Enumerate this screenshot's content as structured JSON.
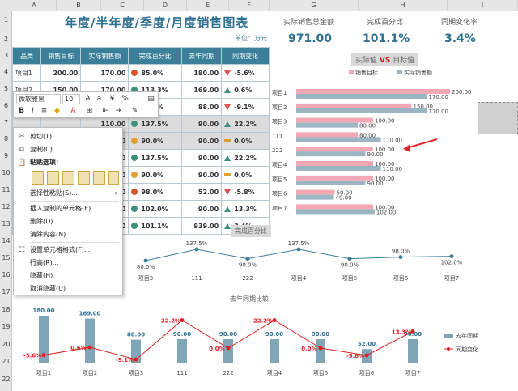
{
  "columns": [
    "A",
    "B",
    "C",
    "D",
    "E",
    "F",
    "G",
    "H",
    "I"
  ],
  "rows": [
    "1",
    "2",
    "3",
    "4",
    "5",
    "6",
    "7",
    "8",
    "9",
    "10",
    "11",
    "12",
    "13",
    "14",
    "15",
    "16",
    "17",
    "18",
    "19",
    "20",
    "21",
    "22"
  ],
  "title": "年度/半年度/季度/月度销售图表",
  "unit": "单位：万元",
  "kpi": {
    "total_label": "实际销售总金额",
    "total_value": "971.00",
    "pct_label": "完成百分比",
    "pct_value": "101.1%",
    "yoy_label": "同期变化率",
    "yoy_value": "3.4%"
  },
  "table": {
    "headers": [
      "品类",
      "销售目标",
      "实际销售额",
      "完成百分比",
      "去年同期",
      "同期变化"
    ],
    "rows": [
      {
        "name": "项目1",
        "target": "200.00",
        "actual": "170.00",
        "pct": "85.0%",
        "last": "180.00",
        "chg": "-5.6%",
        "dot": "#d9532b",
        "arrow": "dn"
      },
      {
        "name": "项目2",
        "target": "150.00",
        "actual": "170.00",
        "pct": "113.3%",
        "last": "169.00",
        "chg": "0.6%",
        "dot": "#3f8f7f",
        "arrow": "up"
      },
      {
        "name": "项目3",
        "target": "100.00",
        "actual": "80.00",
        "pct": "80.0%",
        "last": "88.00",
        "chg": "-9.1%",
        "dot": "#d9532b",
        "arrow": "dn"
      },
      {
        "name": "",
        "target": "",
        "actual": "110.00",
        "pct": "137.5%",
        "last": "90.00",
        "chg": "22.2%",
        "dot": "#3f8f7f",
        "arrow": "up"
      },
      {
        "name": "",
        "target": "",
        "actual": "90.00",
        "pct": "90.0%",
        "last": "90.00",
        "chg": "0.0%",
        "dot": "#e0a030",
        "arrow": "eq"
      },
      {
        "name": "",
        "target": "",
        "actual": "110.00",
        "pct": "137.5%",
        "last": "90.00",
        "chg": "22.2%",
        "dot": "#3f8f7f",
        "arrow": "up"
      },
      {
        "name": "",
        "target": "",
        "actual": "90.00",
        "pct": "90.0%",
        "last": "90.00",
        "chg": "0.0%",
        "dot": "#e0a030",
        "arrow": "eq"
      },
      {
        "name": "",
        "target": "",
        "actual": "49.00",
        "pct": "98.0%",
        "last": "52.00",
        "chg": "-5.8%",
        "dot": "#d9532b",
        "arrow": "dn"
      },
      {
        "name": "",
        "target": "",
        "actual": "102.00",
        "pct": "102.0%",
        "last": "90.00",
        "chg": "13.3%",
        "dot": "#3f8f7f",
        "arrow": "up"
      },
      {
        "name": "",
        "target": "",
        "actual": "971.00",
        "pct": "101.1%",
        "last": "939.00",
        "chg": "3.4%",
        "dot": "#3f8f7f",
        "arrow": "up"
      }
    ]
  },
  "minibar": {
    "font": "微软雅黑",
    "size": "10",
    "pct": "%",
    "bold": "B",
    "italic": "I",
    "comma": ","
  },
  "context_menu": {
    "items": [
      "剪切(T)",
      "复制(C)",
      "粘贴选项:",
      "选择性粘贴(S)...",
      "插入复制的单元格(E)",
      "删除(D)",
      "清除内容(N)",
      "设置单元格格式(F)...",
      "行高(R)...",
      "隐藏(H)",
      "取消隐藏(U)"
    ]
  },
  "chart_data": [
    {
      "type": "bar",
      "title": "实际值 VS 目标值",
      "title_a": "实际值",
      "title_vs": "VS",
      "title_b": "目标值",
      "categories": [
        "项目1",
        "项目2",
        "项目3",
        "111",
        "222",
        "项目4",
        "项目5",
        "项目6",
        "项目7"
      ],
      "series": [
        {
          "name": "销售目标",
          "color": "#f4a7b4",
          "values": [
            200,
            150,
            100,
            80,
            100,
            100,
            100,
            50,
            100
          ]
        },
        {
          "name": "实际销售额",
          "color": "#9bb5c2",
          "values": [
            170,
            170,
            80,
            110,
            90,
            110,
            90,
            49,
            102
          ]
        }
      ],
      "labels_target": [
        "200.00",
        "150.00",
        "100.00",
        "80.00",
        "100.00",
        "100.00",
        "100.00",
        "50.00",
        "100.00"
      ],
      "labels_actual": [
        "170.00",
        "170.00",
        "80.00",
        "110.00",
        "90.00",
        "110.00",
        "90.00",
        "49.00",
        "102.00"
      ],
      "legend": "top"
    },
    {
      "type": "line",
      "title": "完成百分比",
      "categories": [
        "项目3",
        "111",
        "222",
        "项目4",
        "项目5",
        "项目6",
        "项目7"
      ],
      "values": [
        80.0,
        137.5,
        90.0,
        137.5,
        90.0,
        98.0,
        102.0
      ],
      "labels": [
        "80.0%",
        "137.5%",
        "90.0%",
        "137.5%",
        "90.0%",
        "98.0%",
        "102.0%"
      ],
      "color": "#3b7f98"
    },
    {
      "type": "bar",
      "title": "去年同期比较",
      "categories": [
        "项目1",
        "项目2",
        "项目3",
        "111",
        "222",
        "项目4",
        "项目5",
        "项目6",
        "项目7"
      ],
      "series": [
        {
          "name": "去年同期",
          "color": "#7fa6b6",
          "values": [
            180,
            169,
            88,
            90,
            90,
            90,
            90,
            52,
            90
          ]
        },
        {
          "name": "同期变化",
          "color": "#e02020",
          "values": [
            -5.6,
            0.6,
            -9.1,
            22.2,
            0.0,
            22.2,
            0.0,
            -5.8,
            13.3
          ]
        }
      ],
      "labels_last": [
        "180.00",
        "169.00",
        "88.00",
        "90.00",
        "90.00",
        "90.00",
        "90.00",
        "52.00",
        "90.00"
      ],
      "labels_chg": [
        "-5.6%",
        "0.6%",
        "-9.1%",
        "22.2%",
        "0.0%",
        "22.2%",
        "0.0%",
        "-5.8%",
        "13.3%"
      ],
      "legend": "right"
    }
  ]
}
